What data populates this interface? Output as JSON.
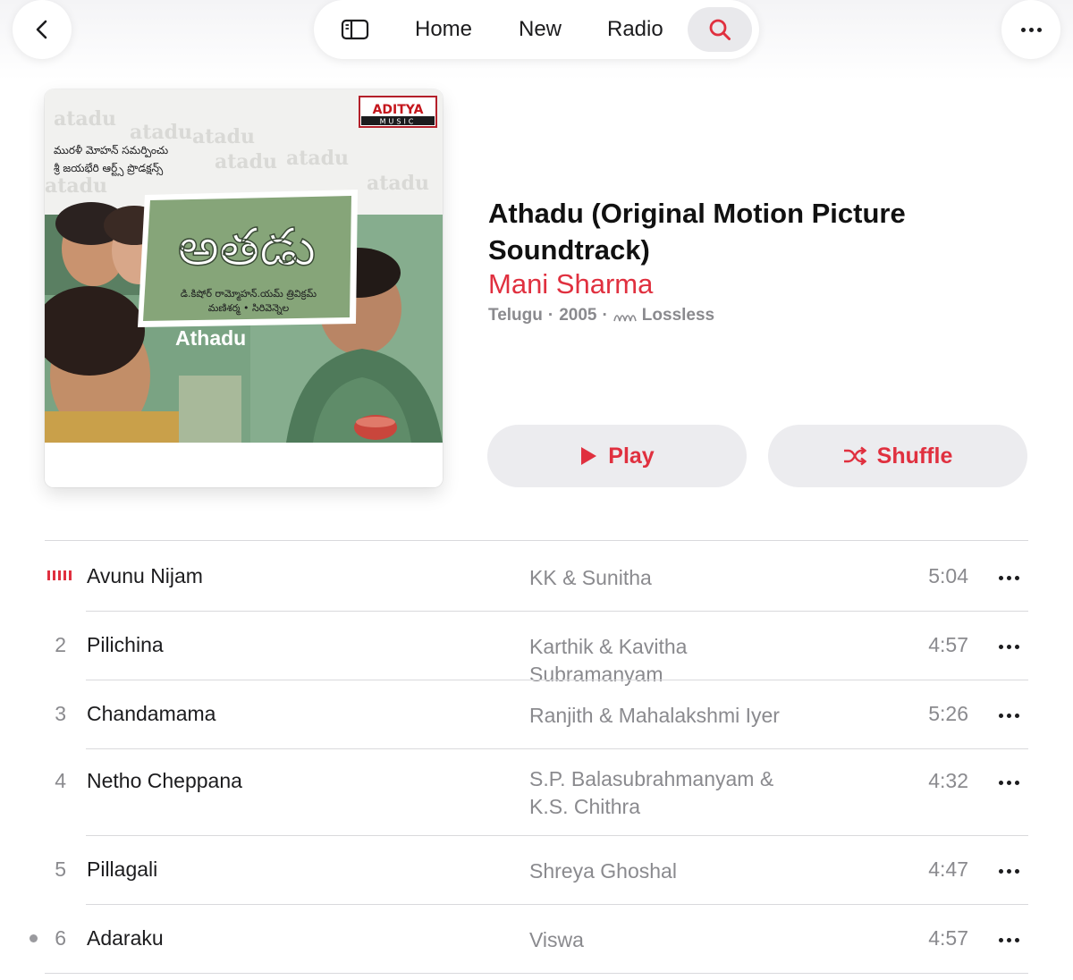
{
  "nav": {
    "items": [
      "Home",
      "New",
      "Radio"
    ],
    "home_label": "Home",
    "new_label": "New",
    "radio_label": "Radio"
  },
  "album": {
    "title": "Athadu (Original Motion Picture Soundtrack)",
    "artist": "Mani Sharma",
    "language": "Telugu",
    "year": "2005",
    "quality": "Lossless",
    "meta_sep": "·",
    "cover": {
      "label_logo": "ADITYA",
      "label_sub": "MUSIC",
      "film_name": "Athadu",
      "credits_line1": "మురళీ మోహన్ సమర్పించు",
      "credits_line2": "శ్రీ జయభేరి ఆర్ట్స్ ప్రొడక్షన్స్",
      "credits_line3": "డి.కిషోర్ రామ్మోహన్.యమ్ త్రివిక్రమ్",
      "credits_line4": "మణిశర్మ • సిరివెన్నెల",
      "telugu_title": "అతడు",
      "bg_word": "atadu"
    }
  },
  "actions": {
    "play_label": "Play",
    "shuffle_label": "Shuffle"
  },
  "tracks": [
    {
      "number": "",
      "title": "Avunu Nijam",
      "artist": "KK & Sunitha",
      "duration": "5:04",
      "now_playing": true
    },
    {
      "number": "2",
      "title": "Pilichina",
      "artist": "Karthik & Kavitha Subramanyam",
      "duration": "4:57"
    },
    {
      "number": "3",
      "title": "Chandamama",
      "artist": "Ranjith & Mahalakshmi Iyer",
      "duration": "5:26"
    },
    {
      "number": "4",
      "title": "Netho Cheppana",
      "artist": "S.P. Balasubrahmanyam & K.S. Chithra",
      "duration": "4:32"
    },
    {
      "number": "5",
      "title": "Pillagali",
      "artist": "Shreya Ghoshal",
      "duration": "4:47"
    },
    {
      "number": "6",
      "title": "Adaraku",
      "artist": "Viswa",
      "duration": "4:57",
      "downloaded": true
    }
  ],
  "colors": {
    "accent": "#e0303f",
    "secondary_text": "#8a8a8e",
    "button_bg": "#ececef"
  }
}
